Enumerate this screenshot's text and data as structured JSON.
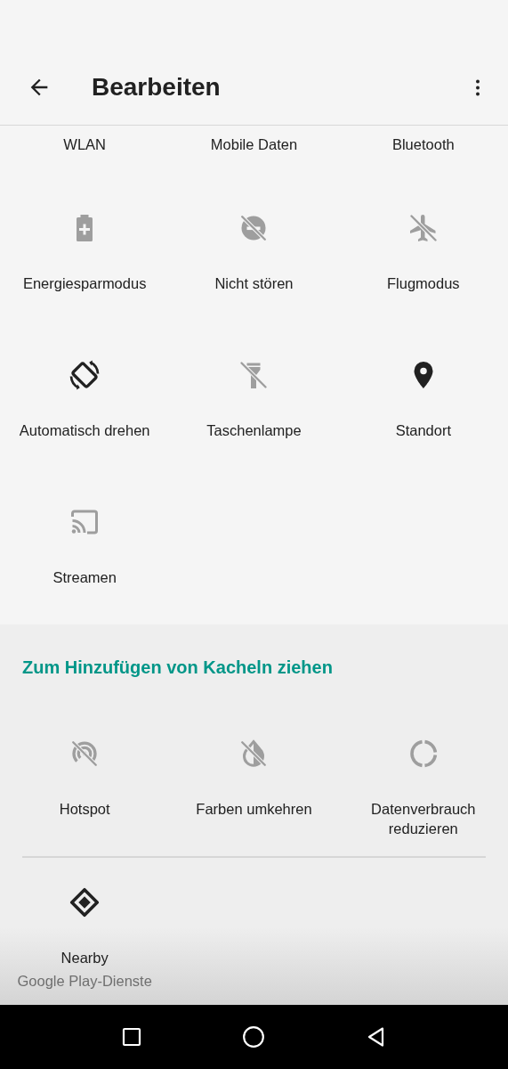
{
  "app_bar": {
    "title": "Bearbeiten"
  },
  "active_tiles": [
    {
      "label": "WLAN",
      "clipped": true
    },
    {
      "label": "Mobile Daten",
      "clipped": true
    },
    {
      "label": "Bluetooth",
      "clipped": true
    },
    {
      "label": "Energiesparmodus",
      "on": false
    },
    {
      "label": "Nicht stören",
      "on": false
    },
    {
      "label": "Flugmodus",
      "on": false
    },
    {
      "label": "Automatisch drehen",
      "on": true
    },
    {
      "label": "Taschenlampe",
      "on": false
    },
    {
      "label": "Standort",
      "on": true
    },
    {
      "label": "Streamen",
      "on": false
    }
  ],
  "available_section": {
    "heading": "Zum Hinzufügen von Kacheln ziehen",
    "groups": [
      [
        {
          "label": "Hotspot",
          "on": false
        },
        {
          "label": "Farben umkehren",
          "on": false
        },
        {
          "label": "Datenverbrauch reduzieren",
          "on": false
        }
      ],
      [
        {
          "label": "Nearby",
          "on": true,
          "subtitle": "Google Play-Dienste"
        }
      ]
    ]
  }
}
